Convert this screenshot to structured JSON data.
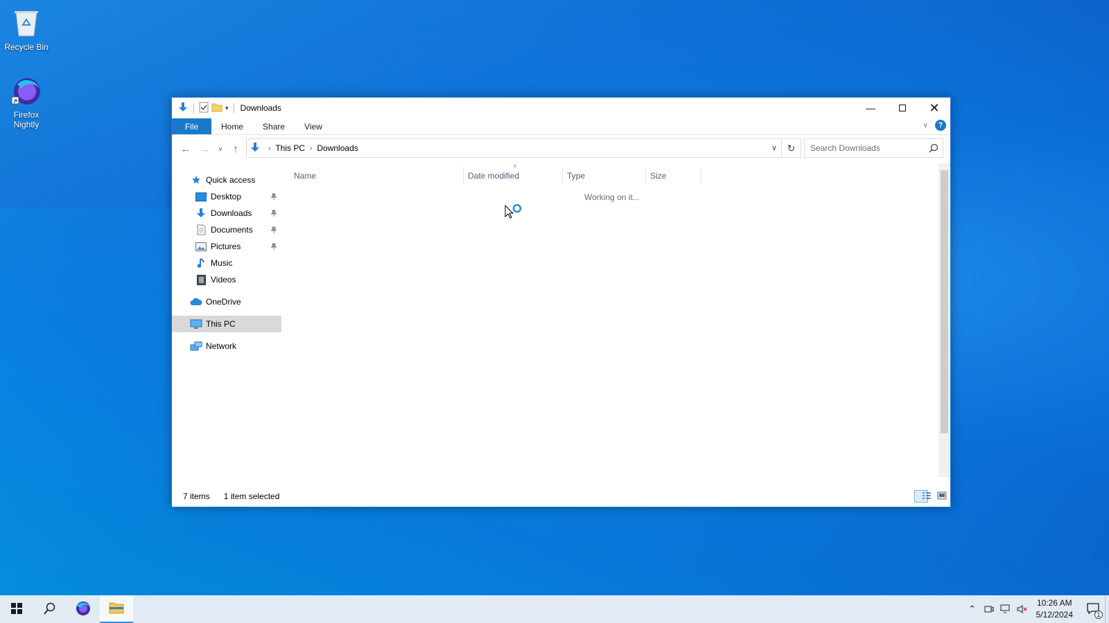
{
  "desktop": {
    "icons": [
      {
        "label": "Recycle Bin",
        "icon": "recycle-bin-icon"
      },
      {
        "label": "Firefox Nightly",
        "icon": "firefox-nightly-icon"
      }
    ]
  },
  "window": {
    "title": "Downloads",
    "ribbon_tabs": [
      "File",
      "Home",
      "Share",
      "View"
    ],
    "address": {
      "crumbs": [
        "This PC",
        "Downloads"
      ]
    },
    "search": {
      "placeholder": "Search Downloads"
    },
    "nav_pane": {
      "quick_access": "Quick access",
      "items": [
        {
          "label": "Desktop",
          "icon": "desktop-folder-icon",
          "pinned": true
        },
        {
          "label": "Downloads",
          "icon": "downloads-folder-icon",
          "pinned": true
        },
        {
          "label": "Documents",
          "icon": "documents-folder-icon",
          "pinned": true
        },
        {
          "label": "Pictures",
          "icon": "pictures-folder-icon",
          "pinned": true
        },
        {
          "label": "Music",
          "icon": "music-folder-icon",
          "pinned": false
        },
        {
          "label": "Videos",
          "icon": "videos-folder-icon",
          "pinned": false
        }
      ],
      "onedrive": "OneDrive",
      "this_pc": "This PC",
      "network": "Network"
    },
    "columns": [
      "Name",
      "Date modified",
      "Type",
      "Size"
    ],
    "loading_text": "Working on it...",
    "status": {
      "items": "7 items",
      "selected": "1 item selected"
    }
  },
  "taskbar": {
    "clock_time": "10:26 AM",
    "clock_date": "5/12/2024",
    "notification_count": "1"
  },
  "colors": {
    "accent": "#1979ca",
    "desktop": "#0a6fd6"
  }
}
